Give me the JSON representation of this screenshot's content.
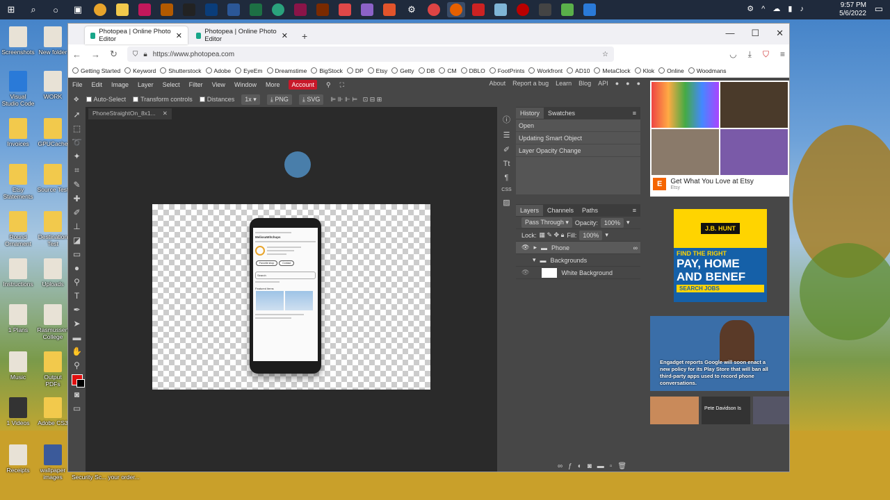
{
  "taskbar": {
    "clock_time": "9:57 PM",
    "clock_date": "5/6/2022"
  },
  "desktop": {
    "icons": [
      "Screenshots",
      "New folder",
      "Visual Studio Code",
      "WORK",
      "Invoices",
      "GPUCache",
      "Etsy Statements",
      "Source Test",
      "Round Ornament",
      "Destination Test",
      "Instructions",
      "Uploads",
      "1 Plans",
      "Rasmussen College",
      "Music",
      "Output PDFs",
      "1 Videos",
      "Adobe CS3",
      "Receipts",
      "wallpaper images",
      "Security Sc...",
      "your order..."
    ]
  },
  "browser": {
    "tabs": [
      {
        "label": "Photopea | Online Photo Editor"
      },
      {
        "label": "Photopea | Online Photo Editor"
      }
    ],
    "url": "https://www.photopea.com",
    "bookmarks": [
      "Getting Started",
      "Keyword",
      "Shutterstock",
      "Adobe",
      "EyeEm",
      "Dreamstime",
      "BigStock",
      "DP",
      "Etsy",
      "Getty",
      "DB",
      "CM",
      "DBLO",
      "FootPrints",
      "Workfront",
      "AD10",
      "MetaClock",
      "Klok",
      "Online",
      "Woodmans"
    ]
  },
  "photopea": {
    "menu": [
      "File",
      "Edit",
      "Image",
      "Layer",
      "Select",
      "Filter",
      "View",
      "Window",
      "More"
    ],
    "account": "Account",
    "links": [
      "About",
      "Report a bug",
      "Learn",
      "Blog",
      "API"
    ],
    "options": {
      "auto_select": "Auto-Select",
      "transform_controls": "Transform controls",
      "distances": "Distances",
      "scale": "1x",
      "png": "PNG",
      "svg": "SVG"
    },
    "doc_tab": "PhoneStraightOn_8x1..."
  },
  "history": {
    "tabs": [
      "History",
      "Swatches"
    ],
    "items": [
      "Open",
      "Updating Smart Object",
      "Layer Opacity Change"
    ]
  },
  "layers": {
    "tabs": [
      "Layers",
      "Channels",
      "Paths"
    ],
    "blend": "Pass Through",
    "opacity_label": "Opacity:",
    "opacity": "100%",
    "lock_label": "Lock:",
    "fill_label": "Fill:",
    "fill": "100%",
    "rows": [
      "Phone",
      "Backgrounds",
      "White Background"
    ]
  },
  "ads": {
    "etsy_text": "Get What You Love at Etsy",
    "etsy_sub": "Etsy",
    "jb_logo": "J.B. HUNT",
    "jb_find": "FIND THE RIGHT",
    "jb_pay": "PAY, HOME",
    "jb_and": "AND BENEF",
    "jb_search": "SEARCH JOBS",
    "news": "Engadget reports Google will soon enact a new policy for its Play Store that will ban all third-party apps used to record phone conversations.",
    "thumb_caption": "Pete Davidson Is"
  },
  "phone": {
    "header": "MelissaWitchups",
    "btn1": "Favorite shop",
    "btn2": "Contact",
    "search": "Search",
    "section": "Featured items"
  }
}
